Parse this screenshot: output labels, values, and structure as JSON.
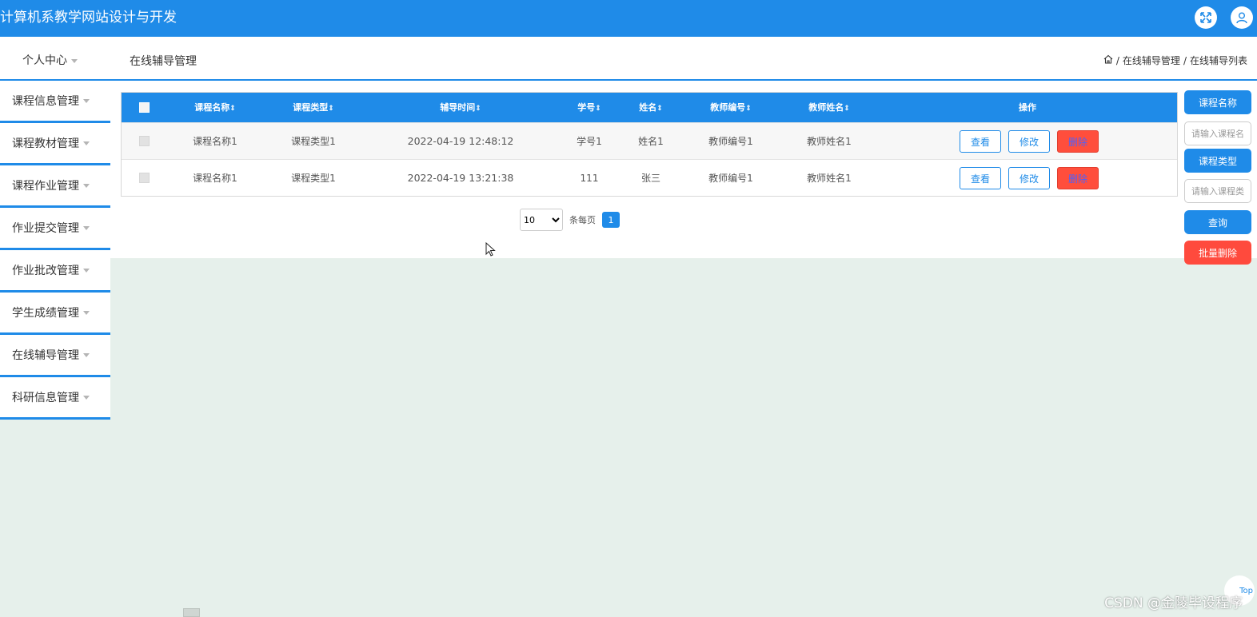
{
  "app": {
    "title": "计算机系教学网站设计与开发"
  },
  "icons": {
    "expand": "expand-icon",
    "user": "user-icon",
    "home": "home-icon",
    "sort": "sort-icon",
    "cursor": "mouse-cursor-icon"
  },
  "header": {
    "personal_center": "个人中心",
    "page_title": "在线辅导管理",
    "breadcrumb": {
      "sep": "/",
      "level1": "在线辅导管理",
      "level2": "在线辅导列表"
    }
  },
  "sidebar": {
    "items": [
      {
        "label": "课程信息管理"
      },
      {
        "label": "课程教材管理"
      },
      {
        "label": "课程作业管理"
      },
      {
        "label": "作业提交管理"
      },
      {
        "label": "作业批改管理"
      },
      {
        "label": "学生成绩管理"
      },
      {
        "label": "在线辅导管理"
      },
      {
        "label": "科研信息管理"
      }
    ]
  },
  "table": {
    "sort_glyph": "⇕",
    "columns": [
      "课程名称",
      "课程类型",
      "辅导时间",
      "学号",
      "姓名",
      "教师编号",
      "教师姓名",
      "操作"
    ],
    "rows": [
      {
        "course_name": "课程名称1",
        "course_type": "课程类型1",
        "time": "2022-04-19 12:48:12",
        "student_no": "学号1",
        "name": "姓名1",
        "teacher_no": "教师编号1",
        "teacher_name": "教师姓名1"
      },
      {
        "course_name": "课程名称1",
        "course_type": "课程类型1",
        "time": "2022-04-19 13:21:38",
        "student_no": "111",
        "name": "张三",
        "teacher_no": "教师编号1",
        "teacher_name": "教师姓名1"
      }
    ],
    "actions": {
      "view": "查看",
      "edit": "修改",
      "delete": "删除"
    }
  },
  "pagination": {
    "page_size": "10",
    "page_size_options": [
      "10"
    ],
    "per_page_label": "条每页",
    "current_page": "1"
  },
  "search": {
    "course_name_label": "课程名称",
    "course_name_placeholder": "请输入课程名称",
    "course_type_label": "课程类型",
    "course_type_placeholder": "请输入课程类型",
    "query_button": "查询",
    "batch_delete_button": "批量删除"
  },
  "back_to_top": "Top",
  "watermark": "CSDN @金陵毕设程序",
  "colors": {
    "primary": "#1f8be8",
    "danger": "#ff4a3d",
    "page_bg": "#e6f0eb"
  }
}
